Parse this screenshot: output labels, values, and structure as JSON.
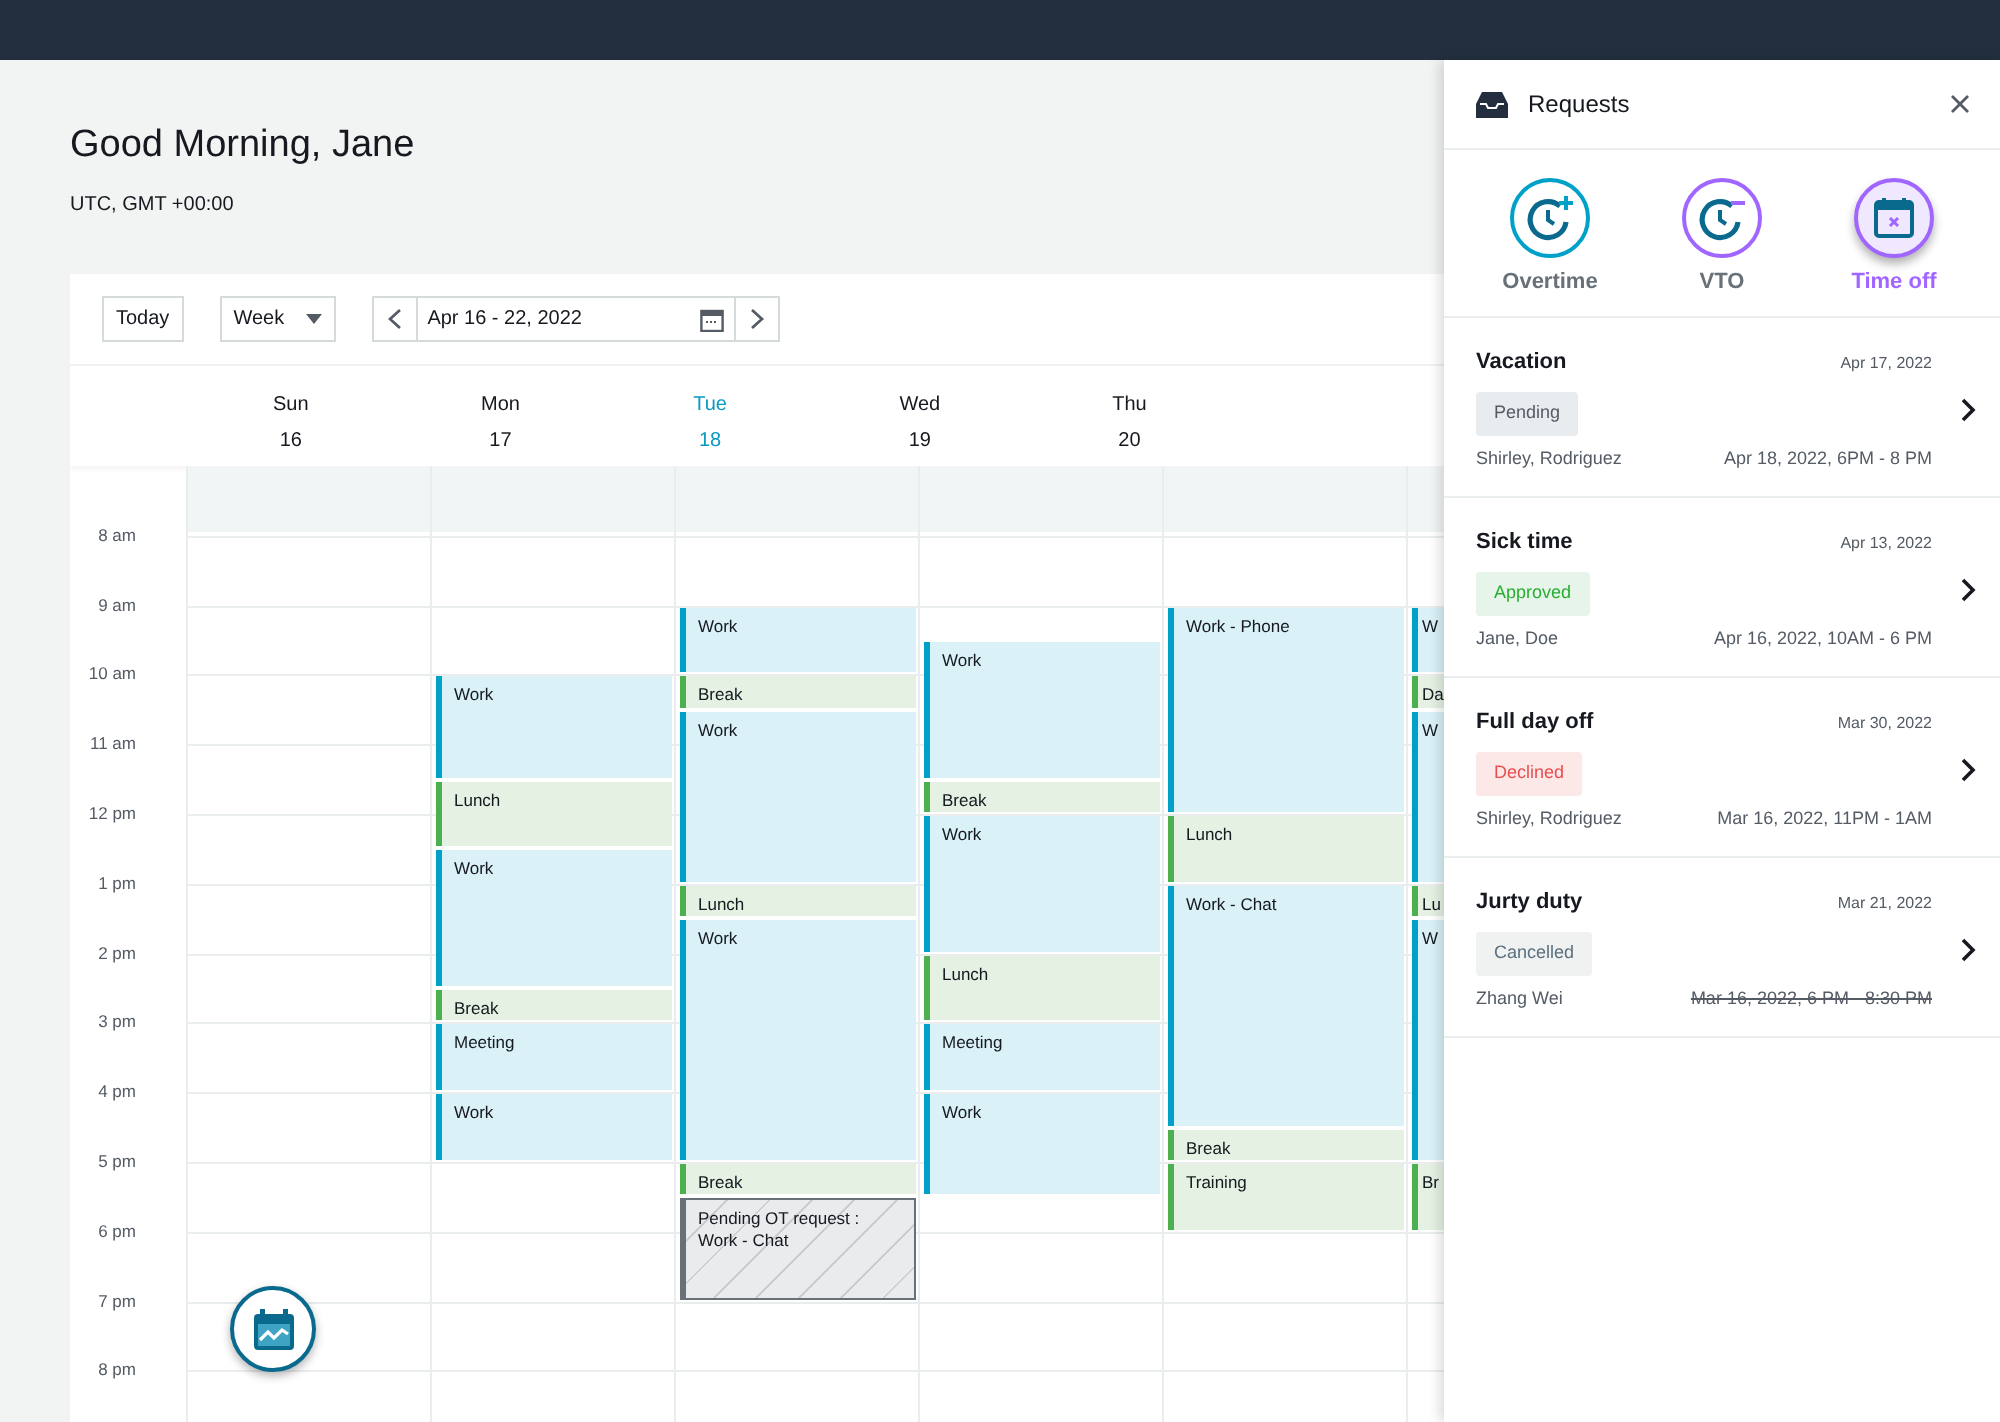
{
  "greeting": {
    "title": "Good Morning, Jane",
    "timezone": "UTC, GMT +00:00"
  },
  "toolbar": {
    "today": "Today",
    "view": "Week",
    "range": "Apr 16 - 22, 2022"
  },
  "calendar": {
    "hours": [
      "8 am",
      "9 am",
      "10 am",
      "11 am",
      "12 pm",
      "1 pm",
      "2 pm",
      "3 pm",
      "4 pm",
      "5 pm",
      "6 pm",
      "7 pm",
      "8 pm"
    ],
    "days": [
      {
        "name": "Sun",
        "date": "16",
        "today": false
      },
      {
        "name": "Mon",
        "date": "17",
        "today": false,
        "events": [
          {
            "kind": "work",
            "title": "Work"
          },
          {
            "kind": "break",
            "title": "Lunch"
          },
          {
            "kind": "work",
            "title": "Work"
          },
          {
            "kind": "break",
            "title": "Break"
          },
          {
            "kind": "work",
            "title": "Meeting"
          },
          {
            "kind": "work",
            "title": "Work"
          }
        ]
      },
      {
        "name": "Tue",
        "date": "18",
        "today": true,
        "events": [
          {
            "kind": "work",
            "title": "Work"
          },
          {
            "kind": "break",
            "title": "Break"
          },
          {
            "kind": "work",
            "title": "Work"
          },
          {
            "kind": "break",
            "title": "Lunch"
          },
          {
            "kind": "work",
            "title": "Work"
          },
          {
            "kind": "break",
            "title": "Break"
          },
          {
            "kind": "pending",
            "title": "Pending OT request : Work - Chat"
          }
        ]
      },
      {
        "name": "Wed",
        "date": "19",
        "today": false,
        "events": [
          {
            "kind": "work",
            "title": "Work"
          },
          {
            "kind": "break",
            "title": "Break"
          },
          {
            "kind": "work",
            "title": "Work"
          },
          {
            "kind": "break",
            "title": "Lunch"
          },
          {
            "kind": "work",
            "title": "Meeting"
          },
          {
            "kind": "work",
            "title": "Work"
          }
        ]
      },
      {
        "name": "Thu",
        "date": "20",
        "today": false,
        "events": [
          {
            "kind": "work",
            "title": "Work - Phone"
          },
          {
            "kind": "break",
            "title": "Lunch"
          },
          {
            "kind": "work",
            "title": "Work - Chat"
          },
          {
            "kind": "break",
            "title": "Break"
          },
          {
            "kind": "break",
            "title": "Training"
          }
        ]
      },
      {
        "events": [
          {
            "kind": "work",
            "title": "W"
          },
          {
            "kind": "break",
            "title": "Da"
          },
          {
            "kind": "work",
            "title": "W"
          },
          {
            "kind": "break",
            "title": "Lu"
          },
          {
            "kind": "work",
            "title": "W"
          },
          {
            "kind": "break",
            "title": "Br"
          }
        ]
      }
    ]
  },
  "requests": {
    "title": "Requests",
    "types": [
      {
        "kind": "overtime",
        "label": "Overtime",
        "selected": false
      },
      {
        "kind": "vto",
        "label": "VTO",
        "selected": false
      },
      {
        "kind": "timeoff",
        "label": "Time off",
        "selected": true
      }
    ],
    "items": [
      {
        "title": "Vacation",
        "date": "Apr 17, 2022",
        "status": "Pending",
        "kind": "pending",
        "person": "Shirley, Rodriguez",
        "range": "Apr 18, 2022, 6PM - 8 PM",
        "struck": false
      },
      {
        "title": "Sick time",
        "date": "Apr 13, 2022",
        "status": "Approved",
        "kind": "approved",
        "person": "Jane, Doe",
        "range": "Apr 16, 2022, 10AM - 6 PM",
        "struck": false
      },
      {
        "title": "Full day off",
        "date": "Mar 30, 2022",
        "status": "Declined",
        "kind": "declined",
        "person": "Shirley, Rodriguez",
        "range": "Mar 16, 2022, 11PM - 1AM",
        "struck": false
      },
      {
        "title": "Jurty duty",
        "date": "Mar 21, 2022",
        "status": "Cancelled",
        "kind": "cancelled",
        "person": "Zhang Wei",
        "range": "Mar 16, 2022, 6 PM - 8:30 PM",
        "struck": true
      }
    ]
  }
}
